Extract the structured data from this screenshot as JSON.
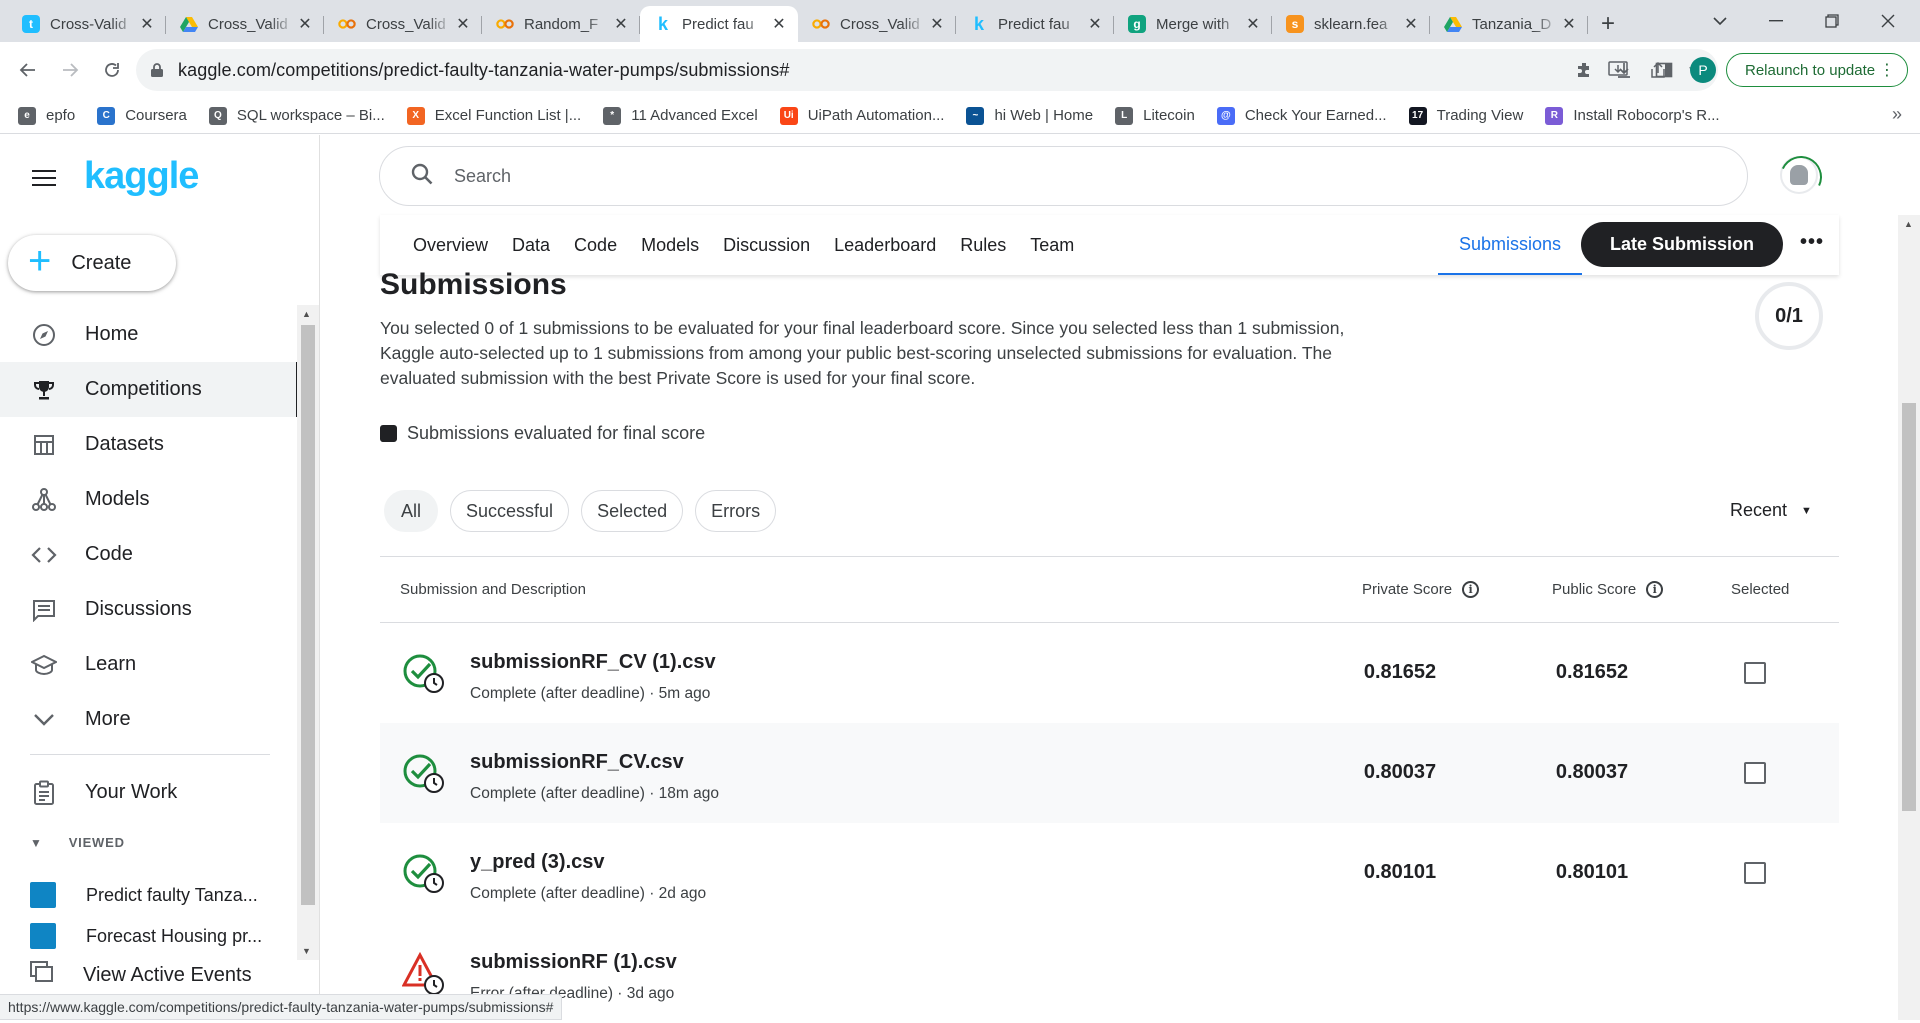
{
  "browser": {
    "tabs": [
      {
        "title": "Cross-Valid",
        "fav_color": "#20beff",
        "fav_char": "t",
        "active": false
      },
      {
        "title": "Cross_Valid",
        "fav_color": "#ffffff",
        "fav_char": "drive",
        "active": false
      },
      {
        "title": "Cross_Valid",
        "fav_color": "#ffffff",
        "fav_char": "co",
        "active": false
      },
      {
        "title": "Random_F",
        "fav_color": "#ffffff",
        "fav_char": "co",
        "active": false
      },
      {
        "title": "Predict fau",
        "fav_color": "#ffffff",
        "fav_char": "k",
        "active": true
      },
      {
        "title": "Cross_Valid",
        "fav_color": "#ffffff",
        "fav_char": "co",
        "active": false
      },
      {
        "title": "Predict fau",
        "fav_color": "#ffffff",
        "fav_char": "k",
        "active": false
      },
      {
        "title": "Merge with",
        "fav_color": "#10a37f",
        "fav_char": "gpt",
        "active": false
      },
      {
        "title": "sklearn.fea",
        "fav_color": "#f7931e",
        "fav_char": "sk",
        "active": false
      },
      {
        "title": "Tanzania_D",
        "fav_color": "#ffffff",
        "fav_char": "drive",
        "active": false
      }
    ],
    "url": "kaggle.com/competitions/predict-faulty-tanzania-water-pumps/submissions#",
    "profile_initial": "P",
    "relaunch_label": "Relaunch to update",
    "bookmarks": [
      {
        "label": "epfo",
        "color": "#5f6368",
        "char": "e"
      },
      {
        "label": "Coursera",
        "color": "#2a73cc",
        "char": "C"
      },
      {
        "label": "SQL workspace – Bi...",
        "color": "#5f6368",
        "char": "Q"
      },
      {
        "label": "Excel Function List |...",
        "color": "#f26522",
        "char": "X"
      },
      {
        "label": "11 Advanced Excel",
        "color": "#5f6368",
        "char": "*"
      },
      {
        "label": "UiPath Automation...",
        "color": "#fa4616",
        "char": "Ui"
      },
      {
        "label": "hi Web | Home",
        "color": "#0b5394",
        "char": "~"
      },
      {
        "label": "Litecoin",
        "color": "#5f6368",
        "char": "L"
      },
      {
        "label": "Check Your Earned...",
        "color": "#4a6cf7",
        "char": "@"
      },
      {
        "label": "Trading View",
        "color": "#131722",
        "char": "17"
      },
      {
        "label": "Install Robocorp's R...",
        "color": "#7b5cd6",
        "char": "R"
      }
    ],
    "status_url": "https://www.kaggle.com/competitions/predict-faulty-tanzania-water-pumps/submissions#"
  },
  "sidebar": {
    "logo": "kaggle",
    "create_label": "Create",
    "nav": [
      {
        "label": "Home",
        "icon": "compass-icon",
        "active": false
      },
      {
        "label": "Competitions",
        "icon": "trophy-icon",
        "active": true
      },
      {
        "label": "Datasets",
        "icon": "table-icon",
        "active": false
      },
      {
        "label": "Models",
        "icon": "models-icon",
        "active": false
      },
      {
        "label": "Code",
        "icon": "code-icon",
        "active": false
      },
      {
        "label": "Discussions",
        "icon": "discussion-icon",
        "active": false
      },
      {
        "label": "Learn",
        "icon": "school-icon",
        "active": false
      },
      {
        "label": "More",
        "icon": "chevron-down-icon",
        "active": false
      }
    ],
    "your_work": "Your Work",
    "viewed_header": "VIEWED",
    "viewed": [
      "Predict faulty Tanza...",
      "Forecast Housing pr..."
    ],
    "active_events": "View Active Events"
  },
  "search": {
    "placeholder": "Search"
  },
  "competition_tabs": {
    "items": [
      "Overview",
      "Data",
      "Code",
      "Models",
      "Discussion",
      "Leaderboard",
      "Rules",
      "Team"
    ],
    "submissions": "Submissions",
    "late_submission": "Late Submission"
  },
  "page": {
    "title": "Submissions",
    "description": "You selected 0 of 1 submissions to be evaluated for your final leaderboard score. Since you selected less than 1 submission, Kaggle auto-selected up to 1 submissions from among your public best-scoring unselected submissions for evaluation. The evaluated submission with the best Private Score is used for your final score.",
    "selected_ring": "0/1",
    "legend": "Submissions evaluated for final score",
    "filters": [
      "All",
      "Successful",
      "Selected",
      "Errors"
    ],
    "sort": "Recent"
  },
  "table": {
    "headers": {
      "submission": "Submission and Description",
      "private": "Private Score",
      "public": "Public Score",
      "selected": "Selected"
    },
    "rows": [
      {
        "name": "submissionRF_CV (1).csv",
        "status": "Complete (after deadline) · 5m ago",
        "private": "0.81652",
        "public": "0.81652",
        "ok": true
      },
      {
        "name": "submissionRF_CV.csv",
        "status": "Complete (after deadline) · 18m ago",
        "private": "0.80037",
        "public": "0.80037",
        "ok": true
      },
      {
        "name": "y_pred (3).csv",
        "status": "Complete (after deadline) · 2d ago",
        "private": "0.80101",
        "public": "0.80101",
        "ok": true
      },
      {
        "name": "submissionRF (1).csv",
        "status": "Error (after deadline) · 3d ago",
        "private": "",
        "public": "",
        "ok": false
      }
    ]
  }
}
